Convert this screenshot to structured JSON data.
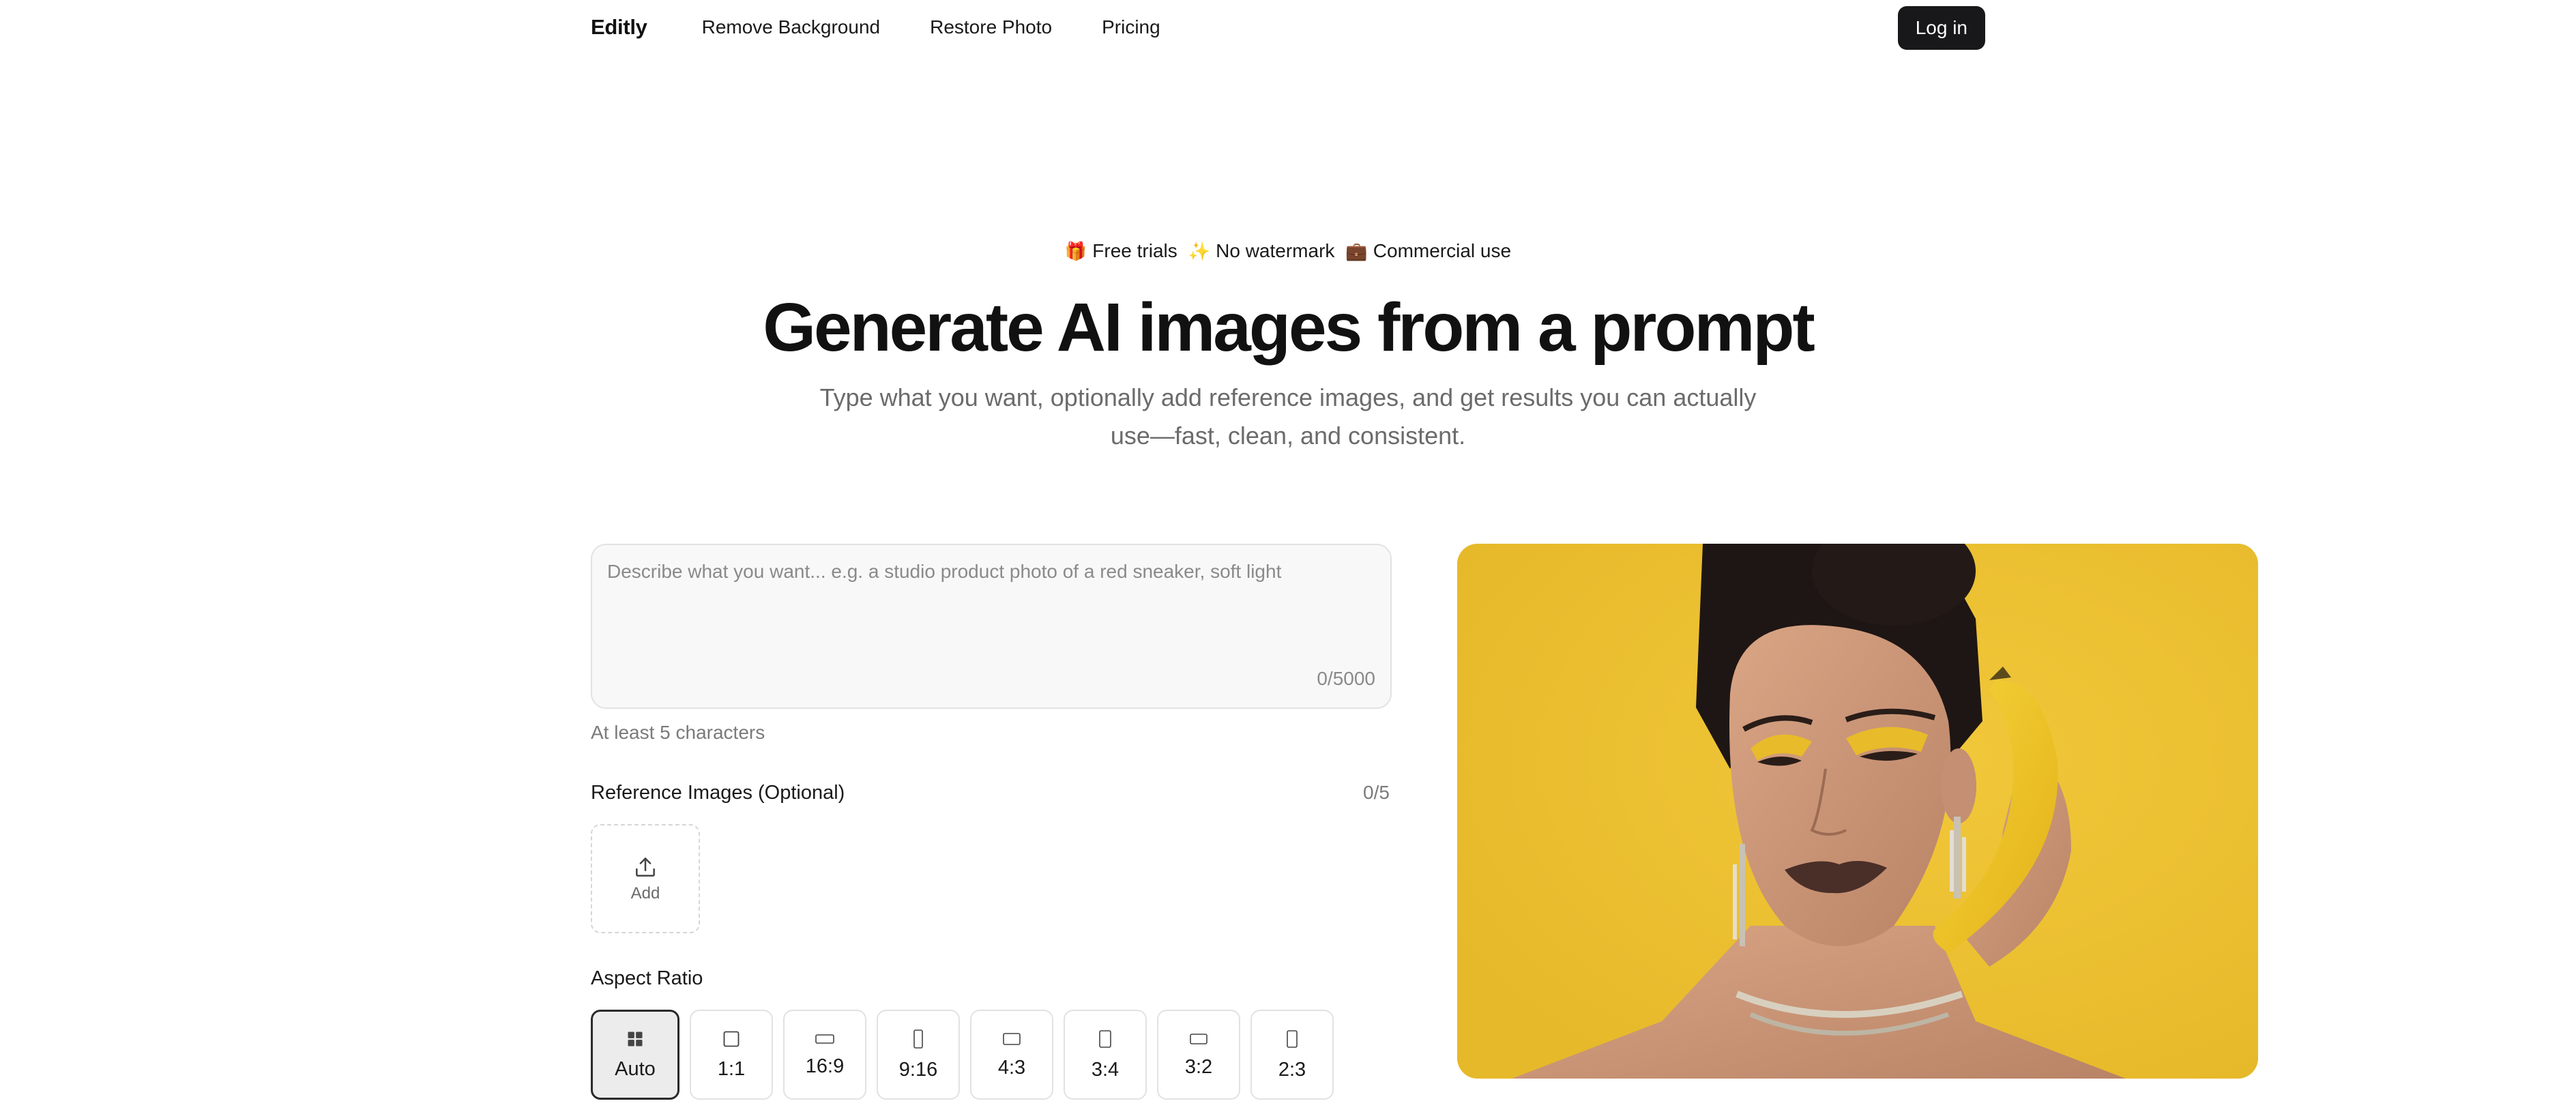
{
  "nav": {
    "brand": "Editly",
    "links": [
      "Remove Background",
      "Restore Photo",
      "Pricing"
    ],
    "login": "Log in"
  },
  "hero": {
    "badges": [
      {
        "icon": "gift-icon",
        "emoji": "🎁",
        "label": "Free trials"
      },
      {
        "icon": "sparkles-icon",
        "emoji": "✨",
        "label": "No watermark"
      },
      {
        "icon": "briefcase-icon",
        "emoji": "💼",
        "label": "Commercial use"
      }
    ],
    "title": "Generate AI images from a prompt",
    "subtitle": "Type what you want, optionally add reference images, and get results you can actually use—fast, clean, and consistent."
  },
  "form": {
    "prompt_placeholder": "Describe what you want... e.g. a studio product photo of a red sneaker, soft light",
    "prompt_value": "",
    "char_counter": "0/5000",
    "hint": "At least 5 characters",
    "reference": {
      "label": "Reference Images (Optional)",
      "count": "0/5",
      "add_label": "Add"
    },
    "aspect": {
      "label": "Aspect Ratio",
      "selected": "Auto",
      "options": [
        "Auto",
        "1:1",
        "16:9",
        "9:16",
        "4:3",
        "3:4",
        "3:2",
        "2:3"
      ]
    }
  },
  "preview": {
    "background_color": "#ebc02f"
  }
}
